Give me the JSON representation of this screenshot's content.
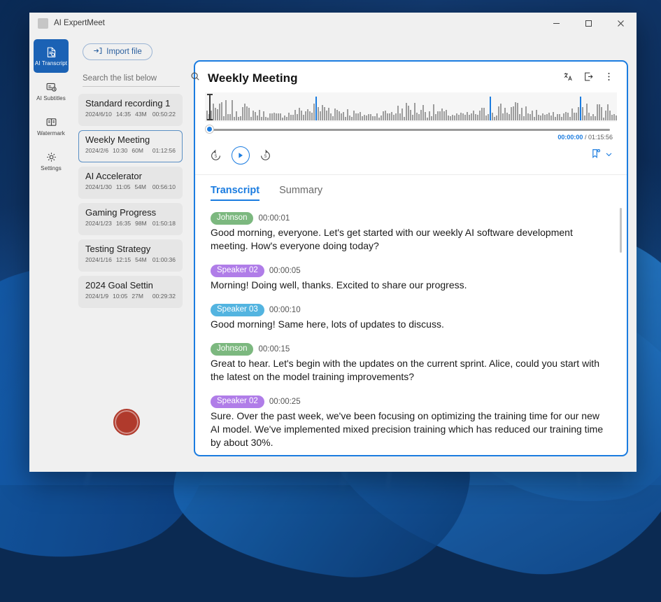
{
  "window": {
    "app_title": "AI ExpertMeet",
    "controls": {
      "minimize": "minimize-icon",
      "maximize": "maximize-icon",
      "close": "close-icon"
    }
  },
  "nav_rail": {
    "items": [
      {
        "label": "AI Transcript",
        "icon": "document-transcript-icon",
        "active": true
      },
      {
        "label": "AI Subtitles",
        "icon": "subtitles-clock-icon",
        "active": false
      },
      {
        "label": "Watermark",
        "icon": "watermark-icon",
        "active": false
      },
      {
        "label": "Settings",
        "icon": "gear-icon",
        "active": false
      }
    ]
  },
  "list_panel": {
    "import_button": "Import file",
    "import_icon": "import-arrow-icon",
    "search_placeholder": "Search the list below",
    "search_value": "",
    "search_icon": "search-icon",
    "record_button": "record-button",
    "files": [
      {
        "title": "Standard recording 1",
        "date": "2024/6/10",
        "time": "14:35",
        "size": "43M",
        "duration": "00:50:22",
        "selected": false
      },
      {
        "title": "Weekly Meeting",
        "date": "2024/2/6",
        "time": "10:30",
        "size": "60M",
        "duration": "01:12:56",
        "selected": true
      },
      {
        "title": "AI Accelerator",
        "date": "2024/1/30",
        "time": "11:05",
        "size": "54M",
        "duration": "00:56:10",
        "selected": false
      },
      {
        "title": "Gaming Progress",
        "date": "2024/1/23",
        "time": "16:35",
        "size": "98M",
        "duration": "01:50:18",
        "selected": false
      },
      {
        "title": "Testing Strategy",
        "date": "2024/1/16",
        "time": "12:15",
        "size": "54M",
        "duration": "01:00:36",
        "selected": false
      },
      {
        "title": "2024 Goal Settin",
        "date": "2024/1/9",
        "time": "10:05",
        "size": "27M",
        "duration": "00:29:32",
        "selected": false
      }
    ]
  },
  "meeting": {
    "title": "Weekly Meeting",
    "header_actions": [
      {
        "name": "translate-icon",
        "label": "Translate"
      },
      {
        "name": "export-icon",
        "label": "Export"
      },
      {
        "name": "more-options-icon",
        "label": "More"
      }
    ],
    "player": {
      "current_time": "00:00:00",
      "separator": " / ",
      "total_time": "01:15:56",
      "progress_percent": 0,
      "rewind_label": "5",
      "forward_label": "5",
      "rewind_icon": "rewind-5-icon",
      "play_icon": "play-icon",
      "forward_icon": "forward-5-icon",
      "bookmark_icon": "add-bookmark-icon",
      "bookmark_chevron": "chevron-down-icon"
    },
    "tabs": [
      {
        "label": "Transcript",
        "active": true
      },
      {
        "label": "Summary",
        "active": false
      }
    ],
    "transcript": [
      {
        "speaker": "Johnson",
        "color": "#7cb87f",
        "time": "00:00:01",
        "text": "Good morning, everyone. Let's get started with our weekly AI software development meeting. How's everyone doing today?"
      },
      {
        "speaker": "Speaker 02",
        "color": "#b07de8",
        "time": "00:00:05",
        "text": "Morning! Doing well, thanks. Excited to share our progress."
      },
      {
        "speaker": "Speaker 03",
        "color": "#53b4e0",
        "time": "00:00:10",
        "text": "Good morning! Same here, lots of updates to discuss."
      },
      {
        "speaker": "Johnson",
        "color": "#7cb87f",
        "time": "00:00:15",
        "text": "Great to hear. Let's begin with the updates on the current sprint. Alice, could you start with the latest on the model training improvements?"
      },
      {
        "speaker": "Speaker 02",
        "color": "#b07de8",
        "time": "00:00:25",
        "text": "Sure. Over the past week, we've been focusing on optimizing the training time for our new AI model. We've implemented mixed precision training which has reduced our training time by about 30%."
      }
    ]
  },
  "colors": {
    "accent": "#1b7ce0",
    "nav_active": "#1b62b5",
    "record": "#b03a2c",
    "waveform_bar": "#9d9d9d",
    "waveform_marker": "#1b7ce0"
  }
}
